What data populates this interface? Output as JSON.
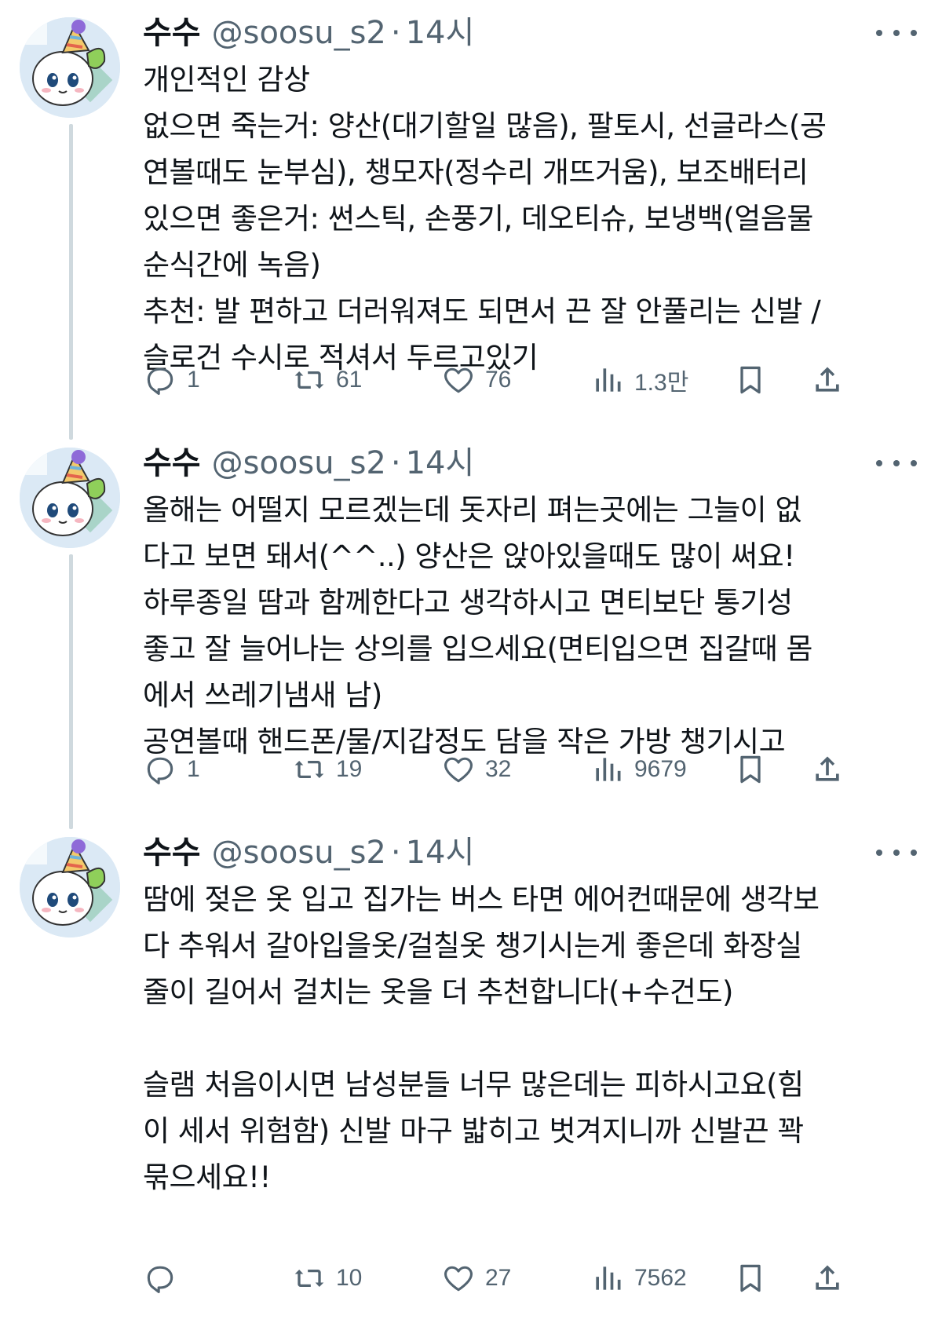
{
  "tweets": [
    {
      "display_name": "수수",
      "handle": "@soosu_s2",
      "separator": "·",
      "time": "14시",
      "lines": [
        "개인적인 감상",
        "없으면 죽는거: 양산(대기할일 많음), 팔토시, 선글라스(공",
        "연볼때도 눈부심), 챙모자(정수리 개뜨거움), 보조배터리",
        "있으면 좋은거: 썬스틱, 손풍기, 데오티슈, 보냉백(얼음물",
        "순식간에 녹음)",
        "추천: 발 편하고 더러워져도 되면서 끈 잘 안풀리는 신발 /",
        "슬로건 수시로 적셔서 두르고있기"
      ],
      "replies": "1",
      "retweets": "61",
      "likes": "76",
      "views": "1.3만"
    },
    {
      "display_name": "수수",
      "handle": "@soosu_s2",
      "separator": "·",
      "time": "14시",
      "lines": [
        "올해는 어떨지 모르겠는데 돗자리 펴는곳에는 그늘이 없",
        "다고 보면 돼서(^^..) 양산은 앉아있을때도 많이 써요!",
        "하루종일 땀과 함께한다고 생각하시고 면티보단 통기성",
        "좋고 잘 늘어나는 상의를 입으세요(면티입으면 집갈때 몸",
        "에서 쓰레기냄새 남)",
        "공연볼때 핸드폰/물/지갑정도 담을 작은 가방 챙기시고"
      ],
      "replies": "1",
      "retweets": "19",
      "likes": "32",
      "views": "9679"
    },
    {
      "display_name": "수수",
      "handle": "@soosu_s2",
      "separator": "·",
      "time": "14시",
      "lines": [
        "땀에 젖은 옷 입고 집가는 버스 타면 에어컨때문에 생각보",
        "다 추워서 갈아입을옷/걸칠옷 챙기시는게 좋은데 화장실",
        "줄이 길어서 걸치는 옷을 더 추천합니다(+수건도)",
        "",
        "슬램 처음이시면 남성분들 너무 많은데는 피하시고요(힘",
        "이 세서 위험함) 신발 마구 밟히고 벗겨지니까 신발끈 꽉",
        "묶으세요!!"
      ],
      "replies": "",
      "retweets": "10",
      "likes": "27",
      "views": "7562"
    }
  ],
  "icons": {
    "reply": "reply-icon",
    "retweet": "retweet-icon",
    "like": "like-icon",
    "views": "views-icon",
    "bookmark": "bookmark-icon",
    "share": "share-icon",
    "more": "more-icon"
  },
  "colors": {
    "text": "#0f1419",
    "secondary": "#536471",
    "thread_line": "#cfd9de",
    "background": "#ffffff"
  }
}
